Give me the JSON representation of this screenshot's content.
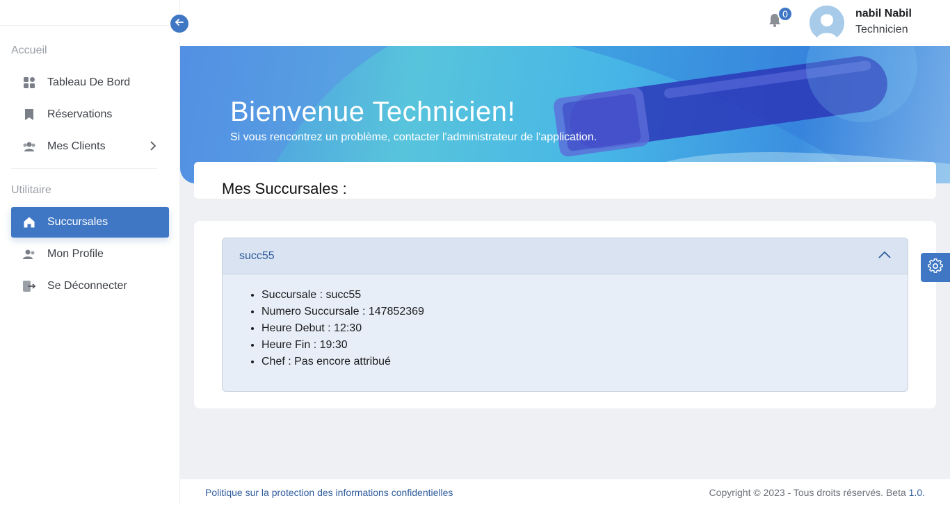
{
  "sidebar": {
    "sections": [
      {
        "title": "Accueil"
      },
      {
        "title": "Utilitaire"
      }
    ],
    "items": [
      {
        "label": "Tableau De Bord"
      },
      {
        "label": "Réservations"
      },
      {
        "label": "Mes Clients"
      },
      {
        "label": "Succursales"
      },
      {
        "label": "Mon Profile"
      },
      {
        "label": "Se Déconnecter"
      }
    ],
    "accent_color": "#3f77c4"
  },
  "topbar": {
    "notification_count": "0",
    "user_name": "nabil Nabil",
    "user_role": "Technicien"
  },
  "banner": {
    "title": "Bienvenue Technicien!",
    "subtitle": "Si vous rencontrez un problème, contacter l'administrateur de l'application."
  },
  "main": {
    "page_title": "Mes Succursales :",
    "accordion": {
      "header": "succ55",
      "details": [
        "Succursale : succ55",
        "Numero Succursale : 147852369",
        "Heure Debut : 12:30",
        "Heure Fin : 19:30",
        "Chef : Pas encore attribué"
      ]
    }
  },
  "footer": {
    "privacy_link": "Politique sur la protection des informations confidentielles",
    "copyright": "Copyright © 2023 - Tous droits réservés. Beta ",
    "version": "1.0."
  }
}
